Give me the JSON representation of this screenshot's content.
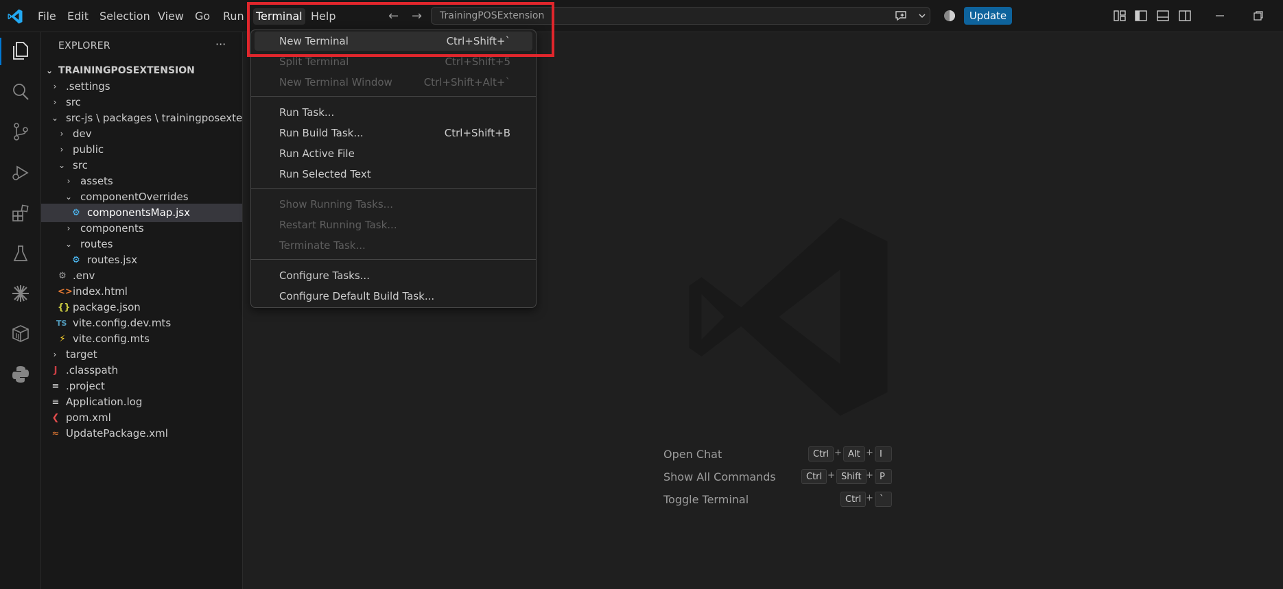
{
  "titlebar": {
    "menus": [
      "File",
      "Edit",
      "Selection",
      "View",
      "Go",
      "Run",
      "Terminal",
      "Help"
    ],
    "command_center": "TrainingPOSExtension",
    "update_label": "Update"
  },
  "sidebar": {
    "title": "EXPLORER",
    "more": "···",
    "tree": [
      {
        "label": "TRAININGPOSEXTENSION",
        "chevron": "open"
      },
      {
        "label": ".settings",
        "chevron": "closed"
      },
      {
        "label": "src",
        "chevron": "closed"
      },
      {
        "label": "src-js \\ packages \\ trainingposexte...",
        "chevron": "open"
      },
      {
        "label": "dev",
        "chevron": "closed"
      },
      {
        "label": "public",
        "chevron": "closed"
      },
      {
        "label": "src",
        "chevron": "open"
      },
      {
        "label": "assets",
        "chevron": "closed"
      },
      {
        "label": "componentOverrides",
        "chevron": "open"
      },
      {
        "label": "componentsMap.jsx",
        "icon": "react-icon"
      },
      {
        "label": "components",
        "chevron": "closed"
      },
      {
        "label": "routes",
        "chevron": "open"
      },
      {
        "label": "routes.jsx",
        "icon": "react-icon"
      },
      {
        "label": ".env",
        "icon": "gear-file-icon"
      },
      {
        "label": "index.html",
        "icon": "html-icon"
      },
      {
        "label": "package.json",
        "icon": "json-icon"
      },
      {
        "label": "vite.config.dev.mts",
        "icon": "typescript-icon"
      },
      {
        "label": "vite.config.mts",
        "icon": "vite-icon"
      },
      {
        "label": "target",
        "chevron": "closed"
      },
      {
        "label": ".classpath",
        "icon": "java-icon"
      },
      {
        "label": ".project",
        "icon": "lines-icon"
      },
      {
        "label": "Application.log",
        "icon": "lines-icon"
      },
      {
        "label": "pom.xml",
        "icon": "maven-icon"
      },
      {
        "label": "UpdatePackage.xml",
        "icon": "rss-icon"
      }
    ]
  },
  "terminal_menu": {
    "items": [
      {
        "label": "New Terminal",
        "shortcut": "Ctrl+Shift+`",
        "enabled": true,
        "focused": true
      },
      {
        "label": "Split Terminal",
        "shortcut": "Ctrl+Shift+5",
        "enabled": false
      },
      {
        "label": "New Terminal Window",
        "shortcut": "Ctrl+Shift+Alt+`",
        "enabled": false
      },
      {
        "label": "Run Task...",
        "shortcut": "",
        "enabled": true
      },
      {
        "label": "Run Build Task...",
        "shortcut": "Ctrl+Shift+B",
        "enabled": true
      },
      {
        "label": "Run Active File",
        "shortcut": "",
        "enabled": true
      },
      {
        "label": "Run Selected Text",
        "shortcut": "",
        "enabled": true
      },
      {
        "label": "Show Running Tasks...",
        "shortcut": "",
        "enabled": false
      },
      {
        "label": "Restart Running Task...",
        "shortcut": "",
        "enabled": false
      },
      {
        "label": "Terminate Task...",
        "shortcut": "",
        "enabled": false
      },
      {
        "label": "Configure Tasks...",
        "shortcut": "",
        "enabled": true
      },
      {
        "label": "Configure Default Build Task...",
        "shortcut": "",
        "enabled": true
      }
    ]
  },
  "watermark": {
    "shortcuts": [
      {
        "label": "Open Chat",
        "keys": [
          "Ctrl",
          "Alt",
          "I"
        ]
      },
      {
        "label": "Show All Commands",
        "keys": [
          "Ctrl",
          "Shift",
          "P"
        ]
      },
      {
        "label": "Toggle Terminal",
        "keys": [
          "Ctrl",
          "`"
        ]
      }
    ],
    "plus": "+"
  },
  "colors": {
    "accent": "#0078d4",
    "update_button": "#0e639c",
    "highlight": "#e0262c"
  }
}
